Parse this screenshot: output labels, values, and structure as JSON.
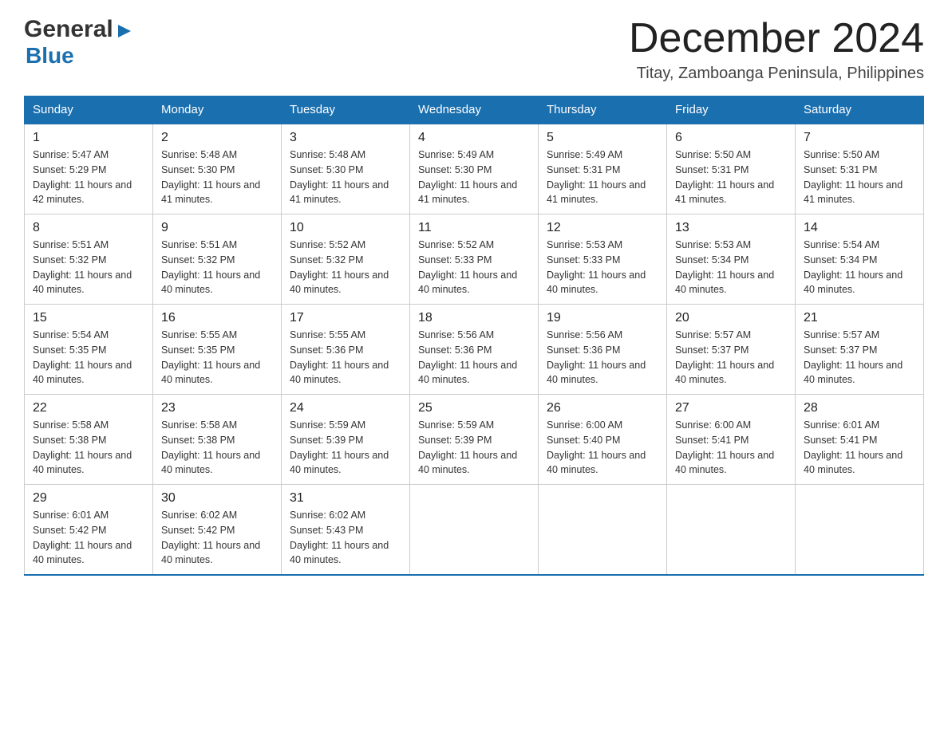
{
  "logo": {
    "general": "General",
    "blue": "Blue",
    "arrow": "▶"
  },
  "header": {
    "month_year": "December 2024",
    "location": "Titay, Zamboanga Peninsula, Philippines"
  },
  "days_of_week": [
    "Sunday",
    "Monday",
    "Tuesday",
    "Wednesday",
    "Thursday",
    "Friday",
    "Saturday"
  ],
  "weeks": [
    [
      {
        "day": "1",
        "sunrise": "5:47 AM",
        "sunset": "5:29 PM",
        "daylight": "11 hours and 42 minutes."
      },
      {
        "day": "2",
        "sunrise": "5:48 AM",
        "sunset": "5:30 PM",
        "daylight": "11 hours and 41 minutes."
      },
      {
        "day": "3",
        "sunrise": "5:48 AM",
        "sunset": "5:30 PM",
        "daylight": "11 hours and 41 minutes."
      },
      {
        "day": "4",
        "sunrise": "5:49 AM",
        "sunset": "5:30 PM",
        "daylight": "11 hours and 41 minutes."
      },
      {
        "day": "5",
        "sunrise": "5:49 AM",
        "sunset": "5:31 PM",
        "daylight": "11 hours and 41 minutes."
      },
      {
        "day": "6",
        "sunrise": "5:50 AM",
        "sunset": "5:31 PM",
        "daylight": "11 hours and 41 minutes."
      },
      {
        "day": "7",
        "sunrise": "5:50 AM",
        "sunset": "5:31 PM",
        "daylight": "11 hours and 41 minutes."
      }
    ],
    [
      {
        "day": "8",
        "sunrise": "5:51 AM",
        "sunset": "5:32 PM",
        "daylight": "11 hours and 40 minutes."
      },
      {
        "day": "9",
        "sunrise": "5:51 AM",
        "sunset": "5:32 PM",
        "daylight": "11 hours and 40 minutes."
      },
      {
        "day": "10",
        "sunrise": "5:52 AM",
        "sunset": "5:32 PM",
        "daylight": "11 hours and 40 minutes."
      },
      {
        "day": "11",
        "sunrise": "5:52 AM",
        "sunset": "5:33 PM",
        "daylight": "11 hours and 40 minutes."
      },
      {
        "day": "12",
        "sunrise": "5:53 AM",
        "sunset": "5:33 PM",
        "daylight": "11 hours and 40 minutes."
      },
      {
        "day": "13",
        "sunrise": "5:53 AM",
        "sunset": "5:34 PM",
        "daylight": "11 hours and 40 minutes."
      },
      {
        "day": "14",
        "sunrise": "5:54 AM",
        "sunset": "5:34 PM",
        "daylight": "11 hours and 40 minutes."
      }
    ],
    [
      {
        "day": "15",
        "sunrise": "5:54 AM",
        "sunset": "5:35 PM",
        "daylight": "11 hours and 40 minutes."
      },
      {
        "day": "16",
        "sunrise": "5:55 AM",
        "sunset": "5:35 PM",
        "daylight": "11 hours and 40 minutes."
      },
      {
        "day": "17",
        "sunrise": "5:55 AM",
        "sunset": "5:36 PM",
        "daylight": "11 hours and 40 minutes."
      },
      {
        "day": "18",
        "sunrise": "5:56 AM",
        "sunset": "5:36 PM",
        "daylight": "11 hours and 40 minutes."
      },
      {
        "day": "19",
        "sunrise": "5:56 AM",
        "sunset": "5:36 PM",
        "daylight": "11 hours and 40 minutes."
      },
      {
        "day": "20",
        "sunrise": "5:57 AM",
        "sunset": "5:37 PM",
        "daylight": "11 hours and 40 minutes."
      },
      {
        "day": "21",
        "sunrise": "5:57 AM",
        "sunset": "5:37 PM",
        "daylight": "11 hours and 40 minutes."
      }
    ],
    [
      {
        "day": "22",
        "sunrise": "5:58 AM",
        "sunset": "5:38 PM",
        "daylight": "11 hours and 40 minutes."
      },
      {
        "day": "23",
        "sunrise": "5:58 AM",
        "sunset": "5:38 PM",
        "daylight": "11 hours and 40 minutes."
      },
      {
        "day": "24",
        "sunrise": "5:59 AM",
        "sunset": "5:39 PM",
        "daylight": "11 hours and 40 minutes."
      },
      {
        "day": "25",
        "sunrise": "5:59 AM",
        "sunset": "5:39 PM",
        "daylight": "11 hours and 40 minutes."
      },
      {
        "day": "26",
        "sunrise": "6:00 AM",
        "sunset": "5:40 PM",
        "daylight": "11 hours and 40 minutes."
      },
      {
        "day": "27",
        "sunrise": "6:00 AM",
        "sunset": "5:41 PM",
        "daylight": "11 hours and 40 minutes."
      },
      {
        "day": "28",
        "sunrise": "6:01 AM",
        "sunset": "5:41 PM",
        "daylight": "11 hours and 40 minutes."
      }
    ],
    [
      {
        "day": "29",
        "sunrise": "6:01 AM",
        "sunset": "5:42 PM",
        "daylight": "11 hours and 40 minutes."
      },
      {
        "day": "30",
        "sunrise": "6:02 AM",
        "sunset": "5:42 PM",
        "daylight": "11 hours and 40 minutes."
      },
      {
        "day": "31",
        "sunrise": "6:02 AM",
        "sunset": "5:43 PM",
        "daylight": "11 hours and 40 minutes."
      },
      null,
      null,
      null,
      null
    ]
  ],
  "labels": {
    "sunrise": "Sunrise:",
    "sunset": "Sunset:",
    "daylight": "Daylight:"
  }
}
